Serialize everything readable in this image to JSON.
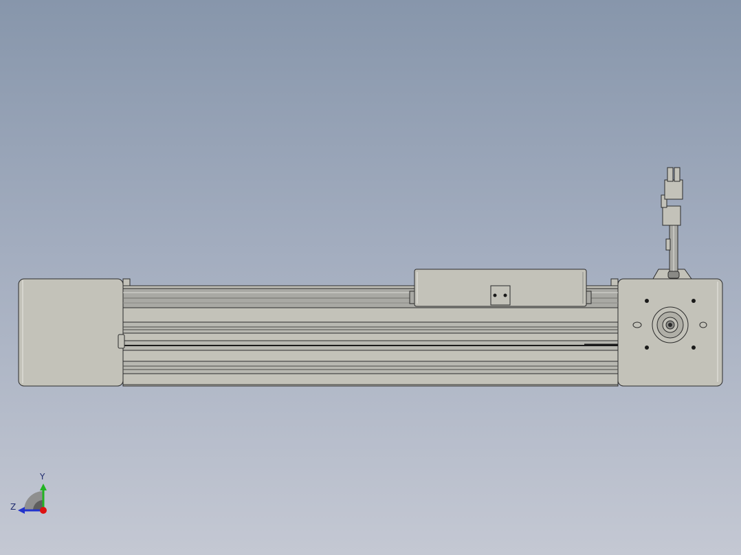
{
  "viewport": {
    "background_top": "#8796ab",
    "background_bottom": "#c4c8d3"
  },
  "model": {
    "part_fill": "#c3c2b9",
    "edge_color": "#2a2a2a",
    "rail_fill": "#a9a9a4"
  },
  "triad": {
    "y_label": "Y",
    "z_label": "Z",
    "y_color": "#22b322",
    "z_color": "#2233cc",
    "x_color": "#dd1111"
  }
}
